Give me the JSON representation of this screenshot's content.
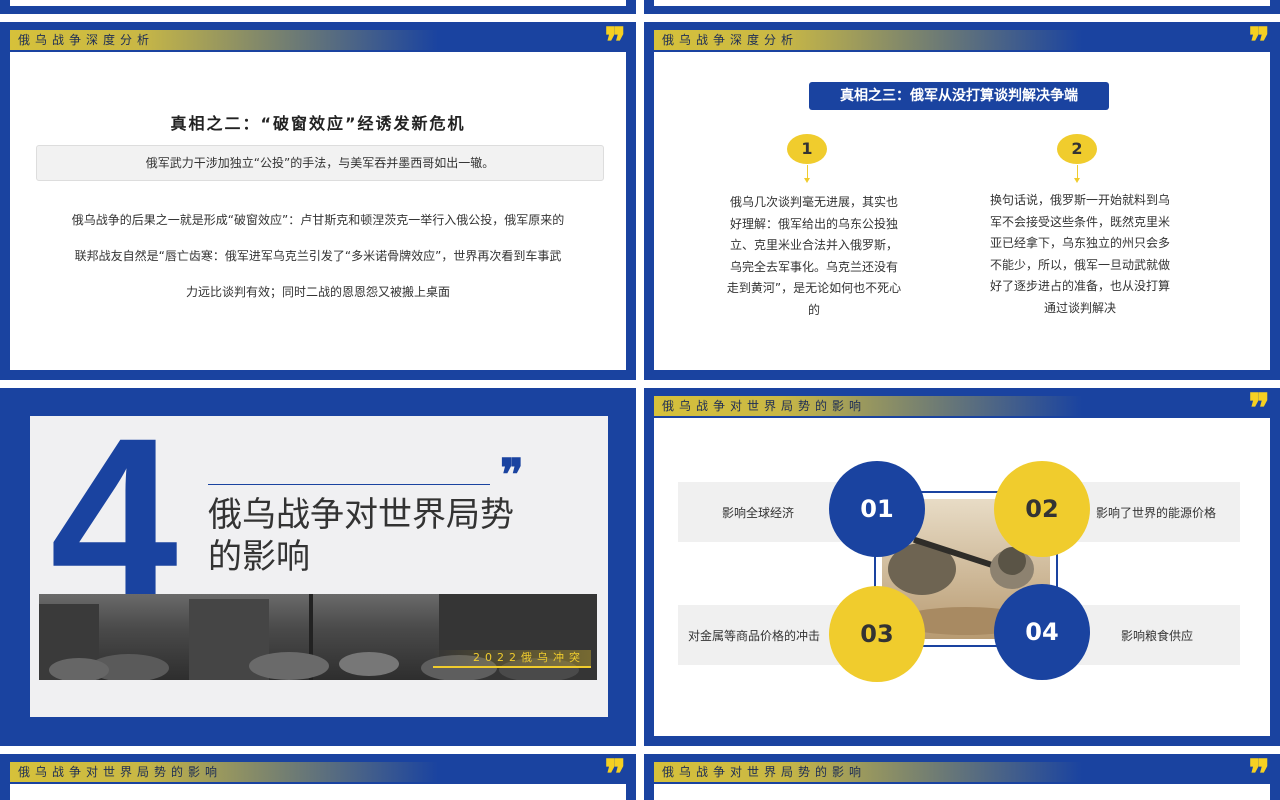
{
  "slides": {
    "s3": {
      "header": "俄乌战争深度分析",
      "title": "真相之二：“破窗效应”经诱发新危机",
      "summary": "俄军武力干涉加独立“公投”的手法，与美军吞并墨西哥如出一辙。",
      "body": "俄乌战争的后果之一就是形成“破窗效应”：卢甘斯克和顿涅茨克一举行入俄公投，俄军原来的联邦战友自然是“唇亡齿寒：俄军进军乌克兰引发了“多米诺骨牌效应”，世界再次看到车事武力远比谈判有效；同时二战的恩恩怨又被搬上桌面"
    },
    "s4": {
      "header": "俄乌战争深度分析",
      "title": "真相之三：俄军从没打算谈判解决争端",
      "points": [
        {
          "num": "1",
          "text": "俄乌几次谈判毫无进展，其实也好理解：俄军给出的乌东公投独立、克里米业合法并入俄罗斯，乌完全去军事化。乌克兰还没有走到黄河”，是无论如何也不死心的"
        },
        {
          "num": "2",
          "text": "换句话说，俄罗斯一开始就料到乌军不会接受这些条件，既然克里米亚已经拿下，乌东独立的州只会多不能少，所以，俄军一旦动武就做好了逐步进占的准备，也从没打算通过谈判解决"
        }
      ]
    },
    "s5": {
      "number": "4",
      "title_line1": "俄乌战争对世界局势",
      "title_line2": "的影响",
      "caption": "2022俄乌冲突"
    },
    "s6": {
      "header": "俄乌战争对世界局势的影响",
      "items": [
        {
          "num": "01",
          "label": "影响全球经济"
        },
        {
          "num": "02",
          "label": "影响了世界的能源价格"
        },
        {
          "num": "03",
          "label": "对金属等商品价格的冲击"
        },
        {
          "num": "04",
          "label": "影响粮食供应"
        }
      ]
    },
    "s7": {
      "header": "俄乌战争对世界局势的影响"
    },
    "s8": {
      "header": "俄乌战争对世界局势的影响"
    }
  },
  "quote_mark": "❞",
  "colors": {
    "blue": "#1a43a0",
    "yellow": "#f0cc2d",
    "grey": "#f0f0f0"
  }
}
